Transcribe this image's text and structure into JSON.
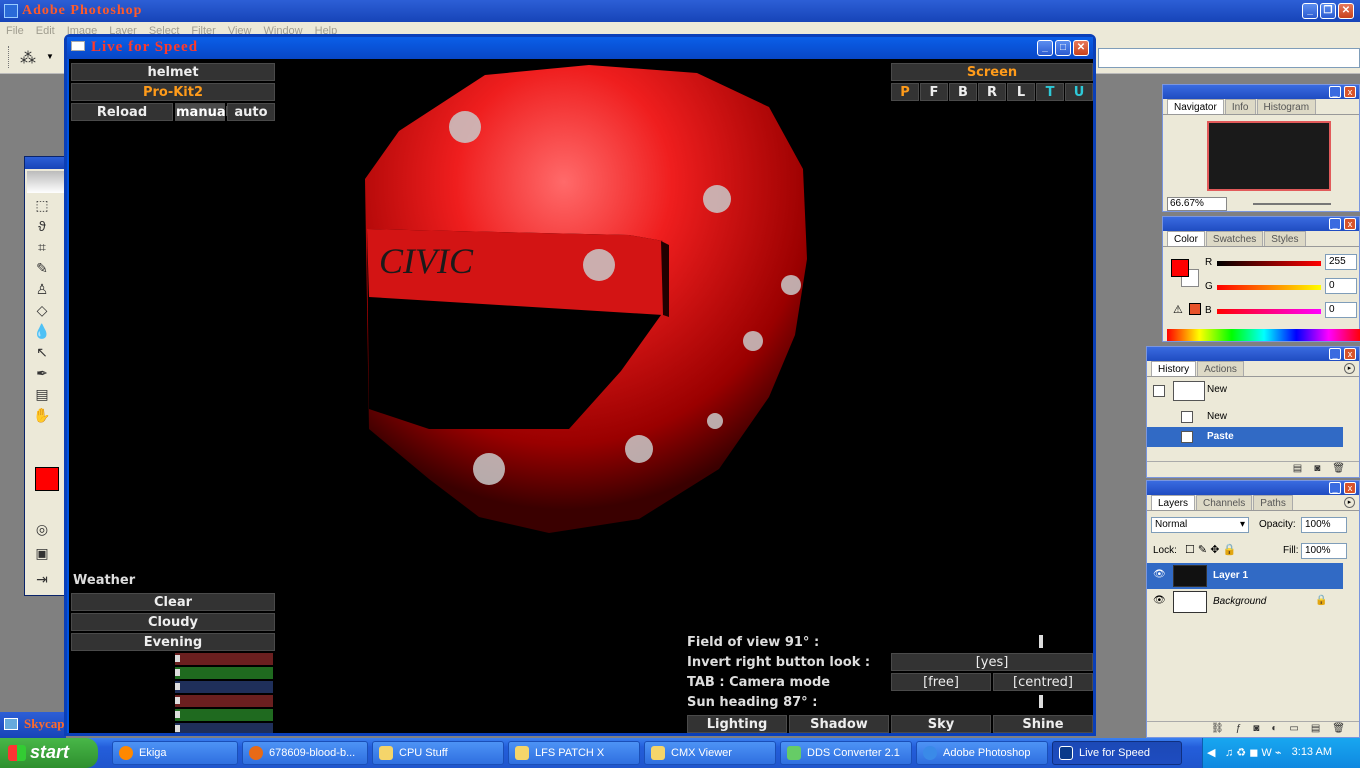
{
  "photoshop": {
    "title": "Adobe Photoshop",
    "menu": [
      "File",
      "Edit",
      "Image",
      "Layer",
      "Select",
      "Filter",
      "View",
      "Window",
      "Help"
    ],
    "navigator": {
      "tabs": [
        "Navigator",
        "Info",
        "Histogram"
      ],
      "zoom": "66.67%"
    },
    "color": {
      "tabs": [
        "Color",
        "Swatches",
        "Styles"
      ],
      "r": "255",
      "g": "0",
      "b": "0",
      "accent": "#ff0000"
    },
    "history": {
      "tabs": [
        "History",
        "Actions"
      ],
      "snapshot": "New",
      "items": [
        "New",
        "Paste"
      ]
    },
    "layers": {
      "tabs": [
        "Layers",
        "Channels",
        "Paths"
      ],
      "blend": "Normal",
      "opacity_label": "Opacity:",
      "opacity": "100%",
      "lock_label": "Lock:",
      "fill_label": "Fill:",
      "fill": "100%",
      "items": [
        "Layer 1",
        "Background"
      ]
    }
  },
  "lfs": {
    "title": "Live for Speed",
    "left_panel": {
      "item": "helmet",
      "skin": "Pro-Kit2",
      "reload": "Reload",
      "manual": "manual",
      "auto": "auto"
    },
    "screen": {
      "label": "Screen",
      "buttons": [
        "P",
        "F",
        "B",
        "R",
        "L",
        "T",
        "U"
      ]
    },
    "helmet_text": "CIVIC",
    "weather": {
      "heading": "Weather",
      "options": [
        "Clear",
        "Cloudy",
        "Evening"
      ]
    },
    "settings": {
      "fov": "Field of view 91° :",
      "invert": "Invert right button look :",
      "invert_val": "[yes]",
      "tab": "TAB : Camera mode",
      "tab_free": "[free]",
      "tab_centred": "[centred]",
      "sun": "Sun heading 87° :"
    },
    "bottom_buttons": [
      "Lighting",
      "Shadow",
      "Sky",
      "Shine"
    ]
  },
  "background_window": {
    "title": "Skycap"
  },
  "taskbar": {
    "start": "start",
    "tasks": [
      "Ekiga",
      "678609-blood-b...",
      "CPU Stuff",
      "LFS PATCH X",
      "CMX Viewer",
      "DDS Converter 2.1",
      "Adobe Photoshop",
      "Live for Speed"
    ],
    "clock": "3:13 AM"
  }
}
